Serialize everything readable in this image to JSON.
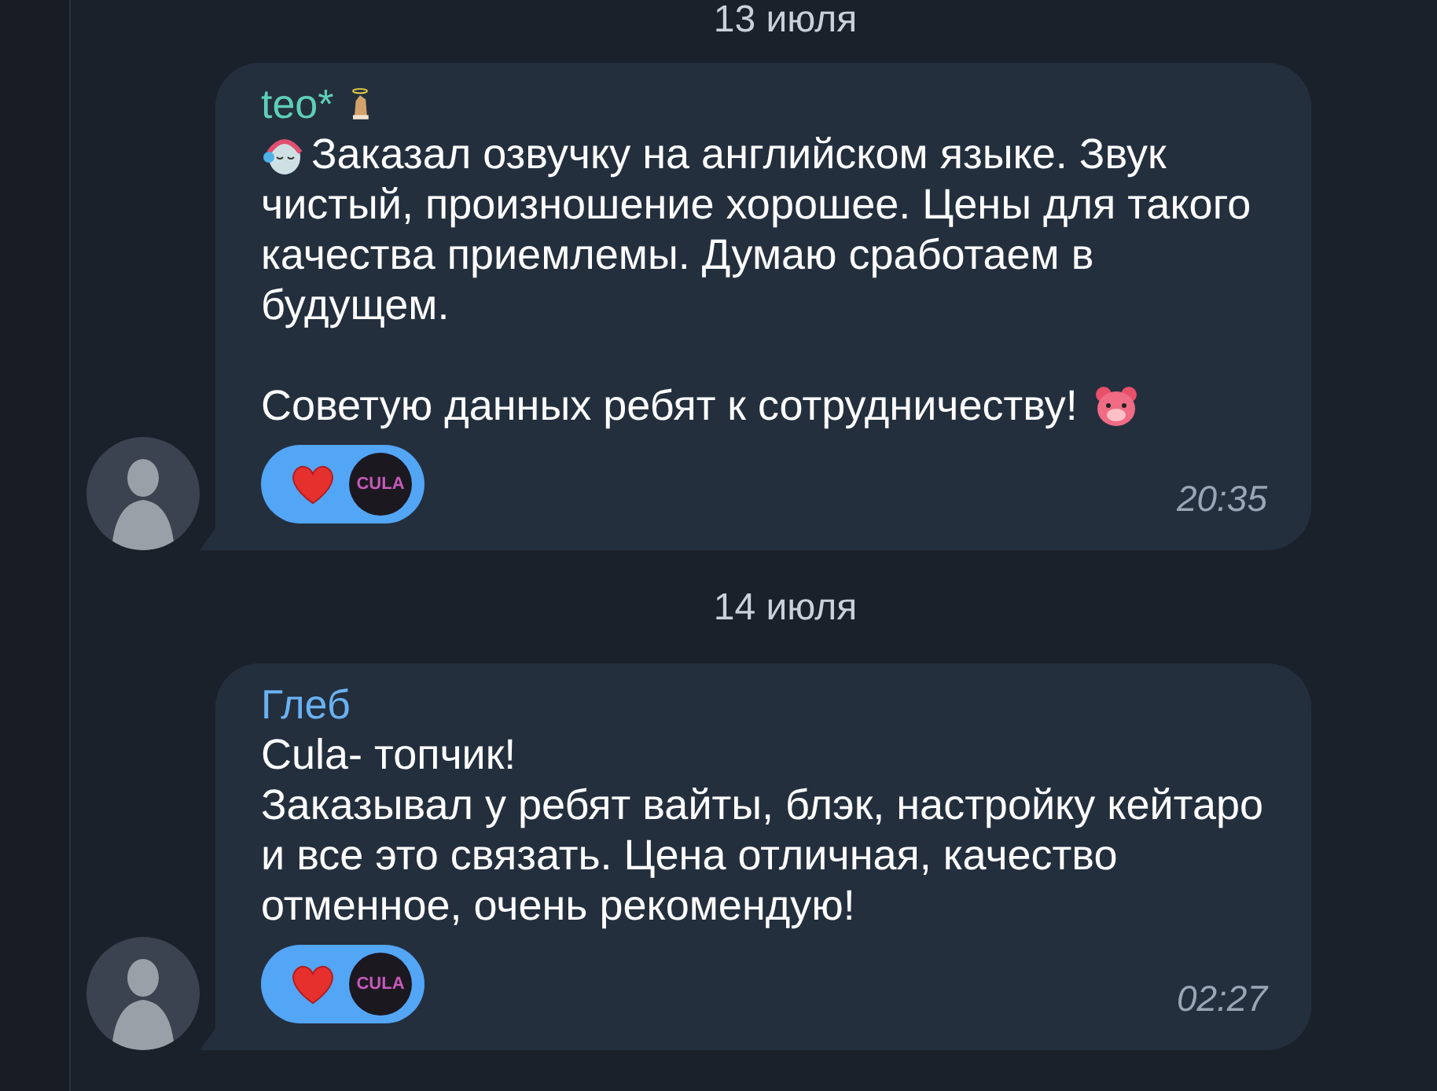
{
  "messages": [
    {
      "date": "13 июля",
      "author": "teo*",
      "color": "#5fcfb7",
      "author_emoji": true,
      "paragraphs": [
        {
          "emoji_before": true,
          "emoji_after": false,
          "lines": [
            "Заказал озвучку на английском языке. Звук",
            "чистый, произношение хорошее. Цены для такого",
            "качества приемлемы. Думаю сработаем в",
            "будущем."
          ]
        },
        {
          "emoji_before": false,
          "emoji_after": true,
          "lines": [
            "Советую данных ребят к сотрудничеству!"
          ]
        }
      ],
      "reaction": {
        "selected": true,
        "logo": "CULA"
      },
      "time": "20:35"
    },
    {
      "date": "14 июля",
      "author": "Глеб",
      "color": "#6ab2f2",
      "author_emoji": false,
      "paragraphs": [
        {
          "emoji_before": false,
          "emoji_after": false,
          "lines": [
            "Cula- топчик!",
            "Заказывал у ребят вайты, блэк, настройку кейтаро",
            "и все это связать. Цена отличная, качество",
            "отменное, очень рекомендую!"
          ]
        }
      ],
      "reaction": {
        "selected": true,
        "logo": "CULA"
      },
      "time": "02:27"
    }
  ]
}
